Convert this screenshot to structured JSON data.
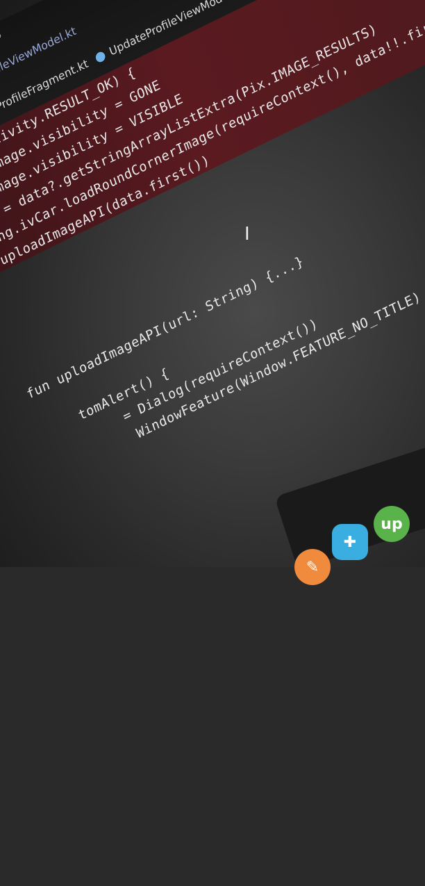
{
  "tabs": [
    {
      "label": "UpdateProfileViewModel.kt",
      "color": "#2d6bd8"
    },
    {
      "label": "UpdateProfileFragment.kt",
      "color": "#d23b3b"
    },
    {
      "label": "UpdateProfileViewModel.kt",
      "color": "#6fb1e8"
    }
  ],
  "code_lines": [
    "== Activity.RESULT_OK) {",
    "xtAddImage.visibility = GONE",
    "d.rlImage.visibility = VISIBLE",
    "data = data?.getStringArrayListExtra(Pix.IMAGE_RESULTS)",
    "inding.ivCar.loadRoundCornerImage(requireContext(), data!!.first())",
    "uploadImageAPI(data.first())",
    "}",
    "}",
    "fun uploadImageAPI(url: String) {...}",
    "tomAlert() {",
    "= Dialog(requireContext())",
    "WindowFeature(Window.FEATURE_NO_TITLE)"
  ],
  "dock_apps": [
    {
      "name": "pencil-app-icon",
      "color": "#f08a3c"
    },
    {
      "name": "tools-app-icon",
      "color": "#3aaee0"
    },
    {
      "name": "upwork-app-icon",
      "label": "up",
      "color": "#5ab24a"
    }
  ]
}
